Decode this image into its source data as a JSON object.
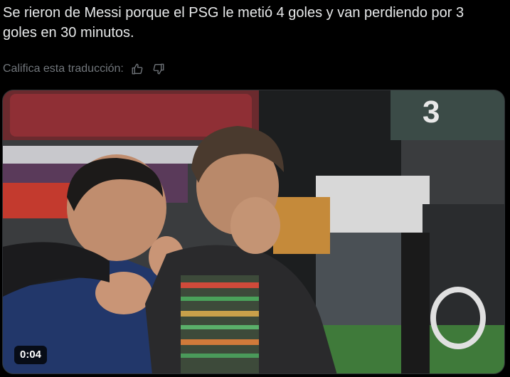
{
  "post": {
    "text": "Se rieron de Messi porque el PSG le metió 4 goles y van perdiendo por 3 goles en 30 minutos."
  },
  "translation": {
    "rate_label": "Califica esta traducción:",
    "like_icon": "thumbs-up-icon",
    "dislike_icon": "thumbs-down-icon"
  },
  "video": {
    "timestamp": "0:04",
    "scene_description_icon": "video-thumbnail",
    "jersey_number_partial": "3"
  },
  "colors": {
    "background": "#000000",
    "text": "#e7e9ea",
    "muted": "#71767b"
  }
}
